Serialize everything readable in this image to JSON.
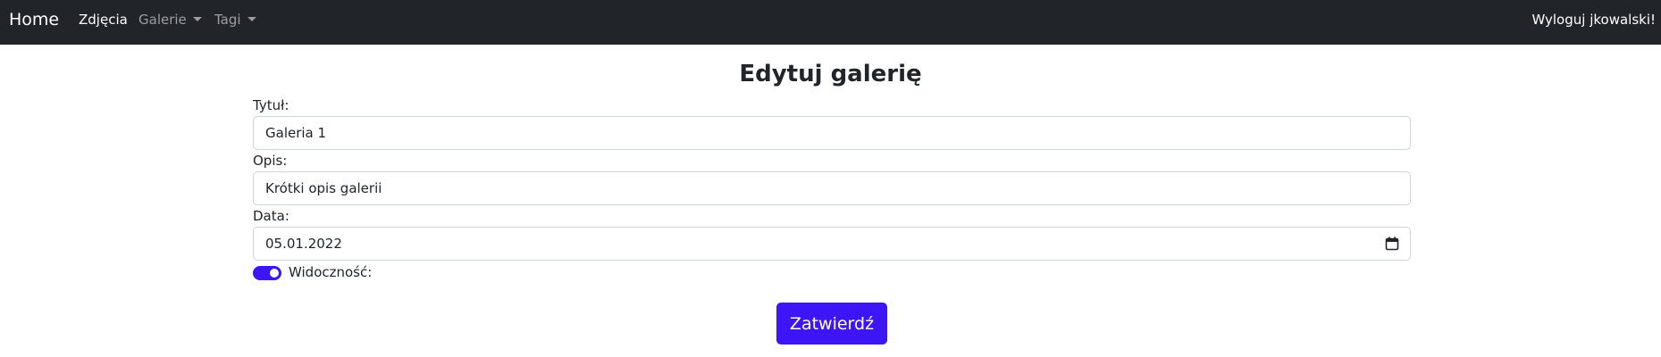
{
  "navbar": {
    "brand": "Home",
    "links": [
      {
        "label": "Zdjęcia"
      },
      {
        "label": "Galerie"
      },
      {
        "label": "Tagi"
      }
    ],
    "logout": "Wyloguj jkowalski!"
  },
  "page": {
    "title": "Edytuj galerię"
  },
  "form": {
    "title_label": "Tytuł:",
    "title_value": "Galeria 1",
    "description_label": "Opis:",
    "description_value": "Krótki opis galerii",
    "date_label": "Data:",
    "date_value": "05.01.2022",
    "visibility_label": "Widoczność:",
    "visibility_checked": true,
    "submit_label": "Zatwierdź"
  },
  "colors": {
    "navbar_bg": "#212529",
    "accent": "#3d16f7"
  }
}
